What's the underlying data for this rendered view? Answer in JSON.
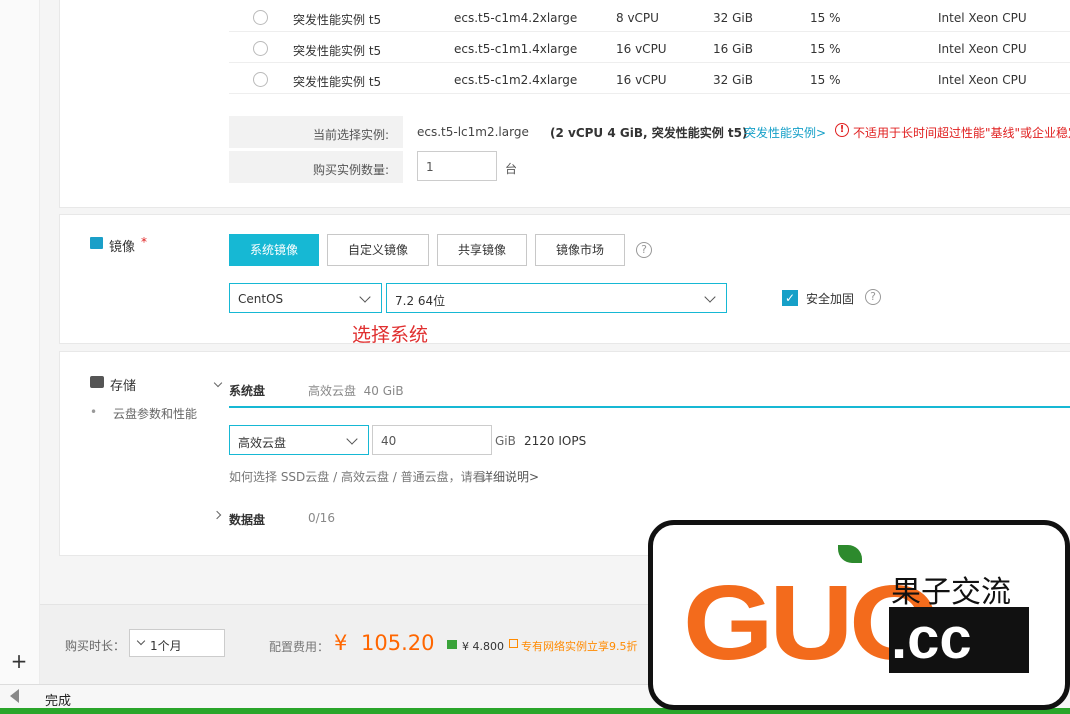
{
  "instance_table": {
    "rows": [
      {
        "family": "突发性能实例 t5",
        "spec": "ecs.t5-c1m4.2xlarge",
        "vcpu": "8 vCPU",
        "memory": "32 GiB",
        "baseline": "15 %",
        "processor": "Intel Xeon CPU"
      },
      {
        "family": "突发性能实例 t5",
        "spec": "ecs.t5-c1m1.4xlarge",
        "vcpu": "16 vCPU",
        "memory": "16 GiB",
        "baseline": "15 %",
        "processor": "Intel Xeon CPU"
      },
      {
        "family": "突发性能实例 t5",
        "spec": "ecs.t5-c1m2.4xlarge",
        "vcpu": "16 vCPU",
        "memory": "32 GiB",
        "baseline": "15 %",
        "processor": "Intel Xeon CPU"
      }
    ]
  },
  "current_selection": {
    "label": "当前选择实例:",
    "value": "ecs.t5-lc1m2.large",
    "detail": "(2 vCPU 4 GiB, 突发性能实例 t5)",
    "link": "突发性能实例>",
    "warning": "不适用于长时间超过性能\"基线\"或企业稳定"
  },
  "quantity": {
    "label": "购买实例数量:",
    "value": "1",
    "unit": "台"
  },
  "image": {
    "section_label": "镜像",
    "required_mark": "*",
    "tabs": [
      "系统镜像",
      "自定义镜像",
      "共享镜像",
      "镜像市场"
    ],
    "os_select": "CentOS",
    "version_select": "7.2 64位",
    "security_label": "安全加固",
    "annotation": "选择系统"
  },
  "storage": {
    "section_label": "存储",
    "sub_link": "云盘参数和性能",
    "system_disk_label": "系统盘",
    "system_disk_summary": "高效云盘  40 GiB",
    "disk_type": "高效云盘",
    "size": "40",
    "unit": "GiB",
    "iops": "2120 IOPS",
    "help_text": "如何选择 SSD云盘 / 高效云盘 / 普通云盘，请看",
    "help_link": "详细说明>",
    "data_disk_label": "数据盘",
    "data_disk_count": "0/16"
  },
  "footer": {
    "duration_label": "购买时长：",
    "duration_value": "1个月",
    "cost_label": "配置费用：",
    "currency": "¥",
    "price": "105.20",
    "saving": "¥ 4.800",
    "promo": "专有网络实例立享9.5折"
  },
  "status": {
    "text": "完成"
  },
  "watermark": {
    "logo": "GUO",
    "domain": ".cc",
    "name": "果子交流"
  },
  "colors": {
    "accent": "#16b8d4",
    "price": "#ff6600",
    "warning": "#e02020",
    "annotation": "#e03030"
  }
}
